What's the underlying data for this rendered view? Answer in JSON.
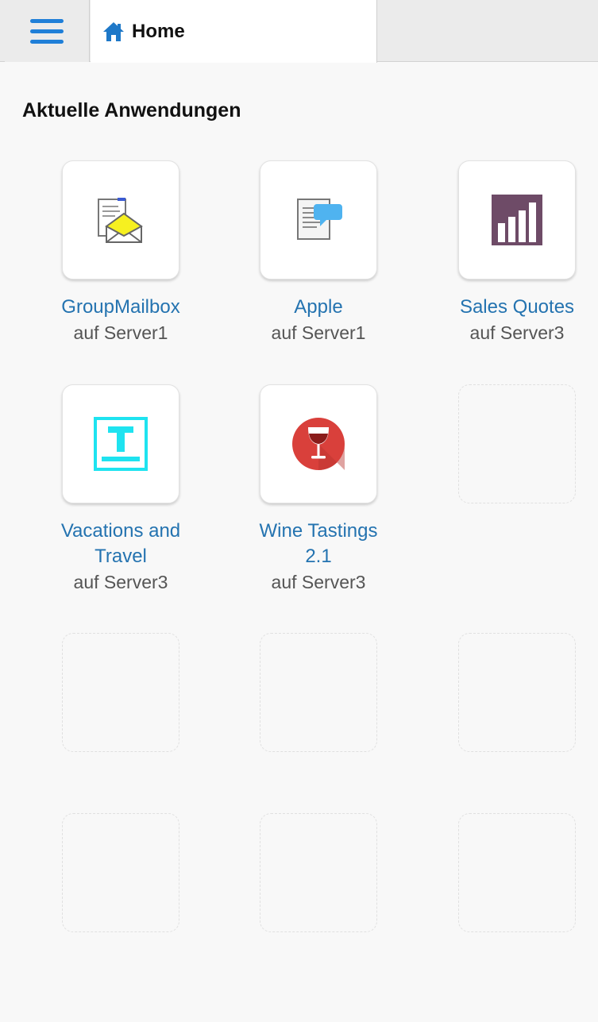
{
  "header": {
    "menu_icon": "hamburger-icon",
    "home_icon": "home-icon",
    "tab_label": "Home"
  },
  "section_title": "Aktuelle Anwendungen",
  "apps": [
    {
      "name": "GroupMailbox",
      "server": "auf Server1",
      "icon": "mailbox-icon"
    },
    {
      "name": "Apple",
      "server": "auf Server1",
      "icon": "document-chat-icon"
    },
    {
      "name": "Sales Quotes",
      "server": "auf Server3",
      "icon": "bar-chart-icon"
    },
    {
      "name_lines": [
        "Vacations and",
        "Travel"
      ],
      "server": "auf Server3",
      "icon": "text-frame-icon"
    },
    {
      "name_lines": [
        "Wine Tastings",
        "2.1"
      ],
      "server": "auf Server3",
      "icon": "wine-glass-icon"
    }
  ],
  "colors": {
    "accent": "#1f7fd8",
    "link": "#2473b0",
    "chart_purple": "#6e4b67",
    "text_frame_cyan": "#1ee3f0",
    "wine_red": "#d9403b"
  }
}
